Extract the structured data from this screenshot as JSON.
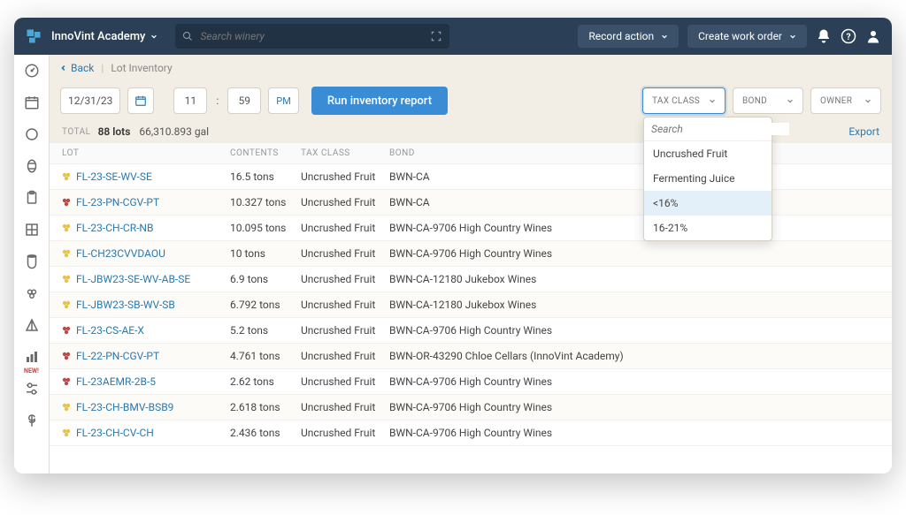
{
  "topbar": {
    "winery_name": "InnoVint Academy",
    "search_placeholder": "Search winery",
    "record_action": "Record action",
    "create_work_order": "Create work order"
  },
  "sidebar": {
    "new_label": "NEW!"
  },
  "breadcrumb": {
    "back": "Back",
    "current": "Lot Inventory"
  },
  "controls": {
    "date": "12/31/23",
    "hour": "11",
    "minute": "59",
    "meridiem": "PM",
    "run_button": "Run inventory report",
    "filters": {
      "tax_class": "TAX CLASS",
      "bond": "BOND",
      "owner": "OWNER"
    }
  },
  "tax_class_dropdown": {
    "search_placeholder": "Search",
    "options": [
      "Uncrushed Fruit",
      "Fermenting Juice",
      "<16%",
      "16-21%"
    ],
    "highlighted_index": 2
  },
  "summary": {
    "total_label": "TOTAL",
    "lots_count": "88 lots",
    "volume": "66,310.893 gal",
    "export": "Export"
  },
  "table": {
    "headers": {
      "lot": "LOT",
      "contents": "CONTENTS",
      "tax_class": "TAX CLASS",
      "bond": "BOND"
    },
    "rows": [
      {
        "color": "yellow",
        "lot": "FL-23-SE-WV-SE",
        "contents": "16.5 tons",
        "tax_class": "Uncrushed Fruit",
        "bond": "BWN-CA"
      },
      {
        "color": "red",
        "lot": "FL-23-PN-CGV-PT",
        "contents": "10.327 tons",
        "tax_class": "Uncrushed Fruit",
        "bond": "BWN-CA"
      },
      {
        "color": "yellow",
        "lot": "FL-23-CH-CR-NB",
        "contents": "10.095 tons",
        "tax_class": "Uncrushed Fruit",
        "bond": "BWN-CA-9706 High Country Wines"
      },
      {
        "color": "yellow",
        "lot": "FL-CH23CVVDAOU",
        "contents": "10 tons",
        "tax_class": "Uncrushed Fruit",
        "bond": "BWN-CA-9706 High Country Wines"
      },
      {
        "color": "yellow",
        "lot": "FL-JBW23-SE-WV-AB-SE",
        "contents": "6.9 tons",
        "tax_class": "Uncrushed Fruit",
        "bond": "BWN-CA-12180 Jukebox Wines"
      },
      {
        "color": "yellow",
        "lot": "FL-JBW23-SB-WV-SB",
        "contents": "6.792 tons",
        "tax_class": "Uncrushed Fruit",
        "bond": "BWN-CA-12180 Jukebox Wines"
      },
      {
        "color": "red",
        "lot": "FL-23-CS-AE-X",
        "contents": "5.2 tons",
        "tax_class": "Uncrushed Fruit",
        "bond": "BWN-CA-9706 High Country Wines"
      },
      {
        "color": "red",
        "lot": "FL-22-PN-CGV-PT",
        "contents": "4.761 tons",
        "tax_class": "Uncrushed Fruit",
        "bond": "BWN-OR-43290 Chloe Cellars (InnoVint Academy)"
      },
      {
        "color": "red",
        "lot": "FL-23AEMR-2B-5",
        "contents": "2.62 tons",
        "tax_class": "Uncrushed Fruit",
        "bond": "BWN-CA-9706 High Country Wines"
      },
      {
        "color": "yellow",
        "lot": "FL-23-CH-BMV-BSB9",
        "contents": "2.618 tons",
        "tax_class": "Uncrushed Fruit",
        "bond": "BWN-CA-9706 High Country Wines"
      },
      {
        "color": "yellow",
        "lot": "FL-23-CH-CV-CH",
        "contents": "2.436 tons",
        "tax_class": "Uncrushed Fruit",
        "bond": "BWN-CA-9706 High Country Wines"
      }
    ]
  }
}
